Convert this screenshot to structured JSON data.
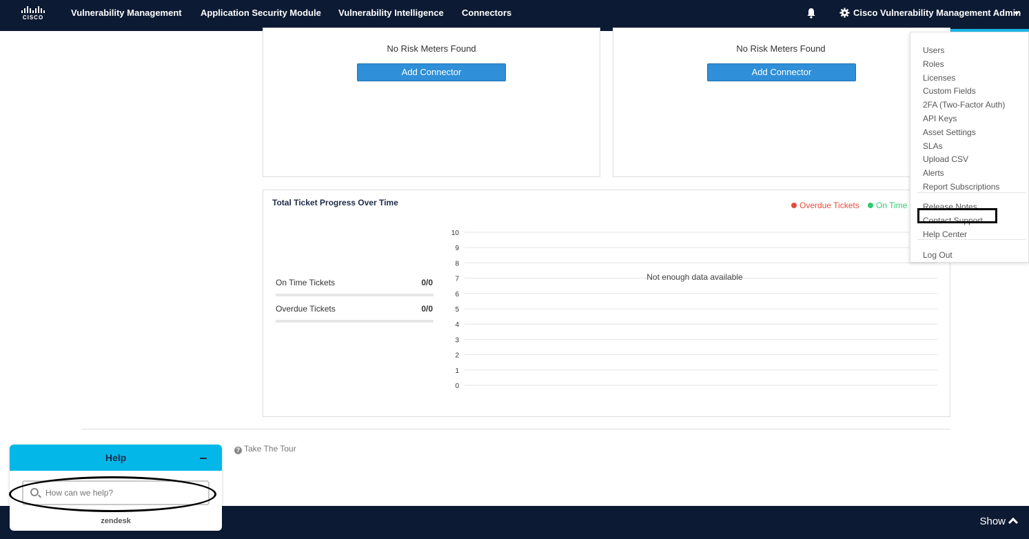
{
  "nav": {
    "logo_text": "CISCO",
    "links": [
      "Vulnerability Management",
      "Application Security Module",
      "Vulnerability Intelligence",
      "Connectors"
    ],
    "admin_label": "Cisco Vulnerability Management Admin"
  },
  "risk_cards": [
    {
      "empty_text": "No Risk Meters Found",
      "button_label": "Add Connector"
    },
    {
      "empty_text": "No Risk Meters Found",
      "button_label": "Add Connector"
    }
  ],
  "ticket_chart": {
    "title": "Total Ticket Progress Over Time",
    "legend": [
      {
        "label": "Overdue Tickets",
        "color": "#e74c3c"
      },
      {
        "label": "On Time",
        "color": "#2ecc71"
      }
    ],
    "stats": [
      {
        "label": "On Time Tickets",
        "value": "0/0"
      },
      {
        "label": "Overdue Tickets",
        "value": "0/0"
      }
    ],
    "empty_text": "Not enough data available"
  },
  "chart_data": {
    "type": "line",
    "title": "Total Ticket Progress Over Time",
    "y_ticks": [
      "10",
      "9",
      "8",
      "7",
      "6",
      "5",
      "4",
      "3",
      "2",
      "1",
      "0"
    ],
    "ylim": [
      0,
      10
    ],
    "grid": true,
    "legend_position": "top-right",
    "series": [
      {
        "name": "Overdue Tickets",
        "values": []
      },
      {
        "name": "On Time",
        "values": []
      }
    ]
  },
  "footer": {
    "tour_label": "Take The Tour"
  },
  "bottom_bar": {
    "show_label": "Show"
  },
  "dropdown": {
    "group1": [
      "Users",
      "Roles",
      "Licenses",
      "Custom Fields",
      "2FA (Two-Factor Auth)",
      "API Keys",
      "Asset Settings",
      "SLAs",
      "Upload CSV",
      "Alerts",
      "Report Subscriptions"
    ],
    "group2": [
      "Release Notes",
      "Contact Support",
      "Help Center"
    ],
    "group3": [
      "Log Out"
    ]
  },
  "help_widget": {
    "title": "Help",
    "search_placeholder": "How can we help?",
    "brand": "zendesk"
  },
  "colors": {
    "nav_bg": "#0d1a33",
    "accent": "#19b5e6",
    "button": "#2f8fd8",
    "help_header": "#03b8e8"
  }
}
